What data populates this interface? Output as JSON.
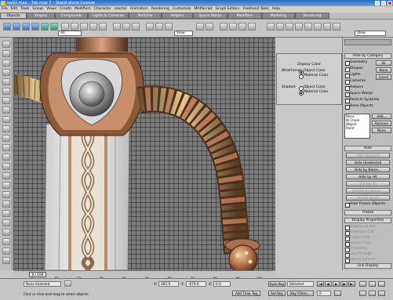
{
  "window": {
    "title": "sw02.max - 3ds max 7 - Stand-alone License"
  },
  "menu": [
    "File",
    "Edit",
    "Tools",
    "Group",
    "Views",
    "Create",
    "Modifiers",
    "Character",
    "reactor",
    "Animation",
    "Rendering",
    "Customize",
    "MAXScript",
    "Graph Editors",
    "Freehand Tools",
    "Help"
  ],
  "tabs": [
    "Objects",
    "Shapes",
    "Compounds",
    "Lights & Cameras",
    "Particles",
    "Helpers",
    "Space Warps",
    "Modifiers",
    "Modeling",
    "Rendering"
  ],
  "toolbar": {
    "selection_filter": "All",
    "coord_system": "View",
    "named_selection": "View"
  },
  "display_color": {
    "heading": "Display Color",
    "wireframe_label": "Wireframe:",
    "shaded_label": "Shaded:",
    "object_color": "Object Color",
    "material_color": "Material Color"
  },
  "command_panel": {
    "hide_by_category": "Hide by Category",
    "categories": [
      "Geometry",
      "Shapes",
      "Lights",
      "Cameras",
      "Helpers",
      "Space Warps",
      "Particle Systems",
      "Bone Objects"
    ],
    "side_buttons": [
      "All",
      "None",
      "Invert"
    ],
    "list_items": [
      "Bone",
      "IK Chain Object",
      "Point"
    ],
    "list_buttons": [
      "Add...",
      "Remove",
      "None"
    ],
    "hide_heading": "Hide",
    "hide_buttons": [
      "Hide Selected",
      "Hide Unselected",
      "Hide by Name...",
      "Hide by Hit",
      "Unhide All",
      "Unhide by Name...",
      "Unhide by Hit"
    ],
    "hide_frozen": "Hide Frozen Objects",
    "freeze_heading": "Freeze",
    "display_properties": "Display Properties",
    "display_prop_items": [
      "Display as Box",
      "Backface Cull",
      "Edges Only",
      "Vertex Ticks",
      "Trajectory",
      "See-Through",
      "Ignore Extents",
      "Show Frozen in Gray",
      "Never Degrade",
      "Vertex Colors"
    ],
    "link_display": "Link Display"
  },
  "timeline": {
    "slider": "0 / 100",
    "ticks": [
      "0",
      "10",
      "20",
      "30",
      "40",
      "50",
      "60",
      "70",
      "80",
      "90",
      "100"
    ]
  },
  "statusbar": {
    "selection": "None Selected",
    "prompt": "Click or click-and-drag to select objects",
    "x": "485.9",
    "y": "-679.0",
    "z": "0.0",
    "add_time_tag": "Add Time Tag",
    "auto_key": "Auto Key",
    "auto_key_value": "Selected",
    "set_key": "Set Key",
    "key_filters": "Key Filters...",
    "frame": "0"
  }
}
